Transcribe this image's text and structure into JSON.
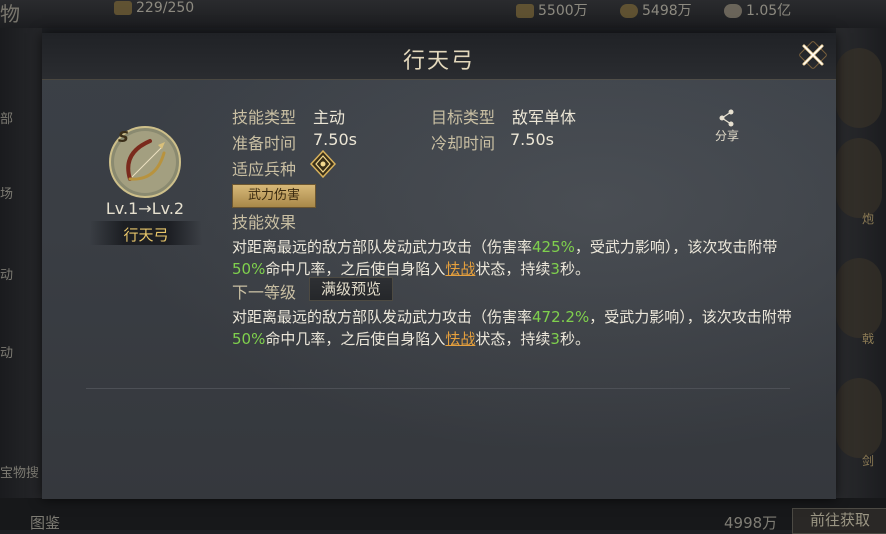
{
  "background": {
    "top_counter": "229/250",
    "top_left_char": "物",
    "resources": [
      {
        "name": "resource-wood",
        "value": "5500万"
      },
      {
        "name": "resource-gold",
        "value": "5498万"
      },
      {
        "name": "resource-silver",
        "value": "1.05亿"
      }
    ],
    "left_tabs": [
      "部",
      "场",
      "动",
      "动"
    ],
    "left_bottom_text": "宝物搜",
    "right_labels": [
      "炮",
      "戟",
      "剑"
    ],
    "bottom": {
      "left_text": "图鉴",
      "count": "4998万",
      "button": "前往获取"
    }
  },
  "dialog": {
    "title": "行天弓",
    "skill": {
      "grade": "S",
      "level_text": "Lv.1→Lv.2",
      "name": "行天弓"
    },
    "info": {
      "type_label": "技能类型",
      "type_value": "主动",
      "target_label": "目标类型",
      "target_value": "敌军单体",
      "prep_label": "准备时间",
      "prep_value": "7.50s",
      "cd_label": "冷却时间",
      "cd_value": "7.50s",
      "troop_label": "适应兵种",
      "damage_tag": "武力伤害"
    },
    "effect_label": "技能效果",
    "effect": {
      "p1": "对距离最远的敌方部队发动武力攻击（伤害率",
      "v1": "425%",
      "p2": "，受武力影响），该次攻击附带",
      "v2": "50%",
      "p3": "命中几率，之后使自身陷入",
      "status": "怯战",
      "p4": "状态，持续",
      "v3": "3",
      "p5": "秒。"
    },
    "next_label": "下一等级",
    "preview_button": "满级预览",
    "next_effect": {
      "p1": "对距离最远的敌方部队发动武力攻击（伤害率",
      "v1": "472.2%",
      "p2": "，受武力影响），该次攻击附带",
      "v2": "50%",
      "p3": "命中几率，之后使自身陷入",
      "status": "怯战",
      "p4": "状态，持续",
      "v3": "3",
      "p5": "秒。"
    },
    "share_label": "分享"
  }
}
